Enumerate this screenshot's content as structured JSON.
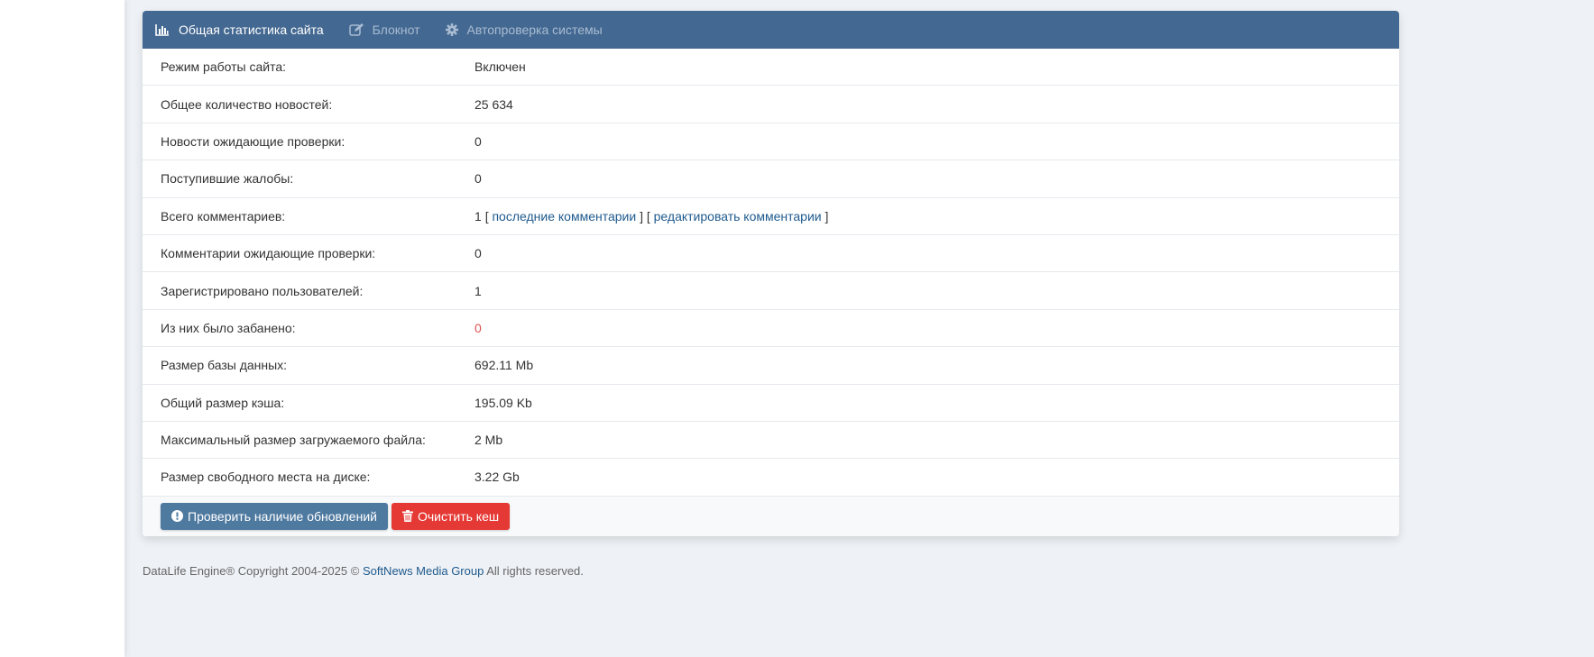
{
  "tabs": [
    {
      "label": "Общая статистика сайта",
      "icon": "bar-chart-icon"
    },
    {
      "label": "Блокнот",
      "icon": "edit-icon"
    },
    {
      "label": "Автопроверка системы",
      "icon": "gear-icon"
    }
  ],
  "rows": [
    {
      "label": "Режим работы сайта:",
      "value": "Включен"
    },
    {
      "label": "Общее количество новостей:",
      "value": "25 634"
    },
    {
      "label": "Новости ожидающие проверки:",
      "value": "0"
    },
    {
      "label": "Поступившие жалобы:",
      "value": "0"
    },
    {
      "label": "Всего комментариев:",
      "value": "1",
      "link1": "последние комментарии",
      "link2": "редактировать комментарии",
      "open": "[",
      "close": "]"
    },
    {
      "label": "Комментарии ожидающие проверки:",
      "value": "0"
    },
    {
      "label": "Зарегистрировано пользователей:",
      "value": "1"
    },
    {
      "label": "Из них было забанено:",
      "value": "0"
    },
    {
      "label": "Размер базы данных:",
      "value": "692.11 Mb"
    },
    {
      "label": "Общий размер кэша:",
      "value": "195.09 Kb"
    },
    {
      "label": "Максимальный размер загружаемого файла:",
      "value": "2 Mb"
    },
    {
      "label": "Размер свободного места на диске:",
      "value": "3.22 Gb"
    }
  ],
  "buttons": {
    "check_updates": "Проверить наличие обновлений",
    "clear_cache": "Очистить кеш"
  },
  "footer": {
    "prefix": "DataLife Engine® Copyright 2004-2025 ©",
    "link": "SoftNews Media Group",
    "suffix": "All rights reserved."
  },
  "colors": {
    "header": "#436891",
    "danger": "#e53935",
    "primary": "#4f7aa0"
  }
}
